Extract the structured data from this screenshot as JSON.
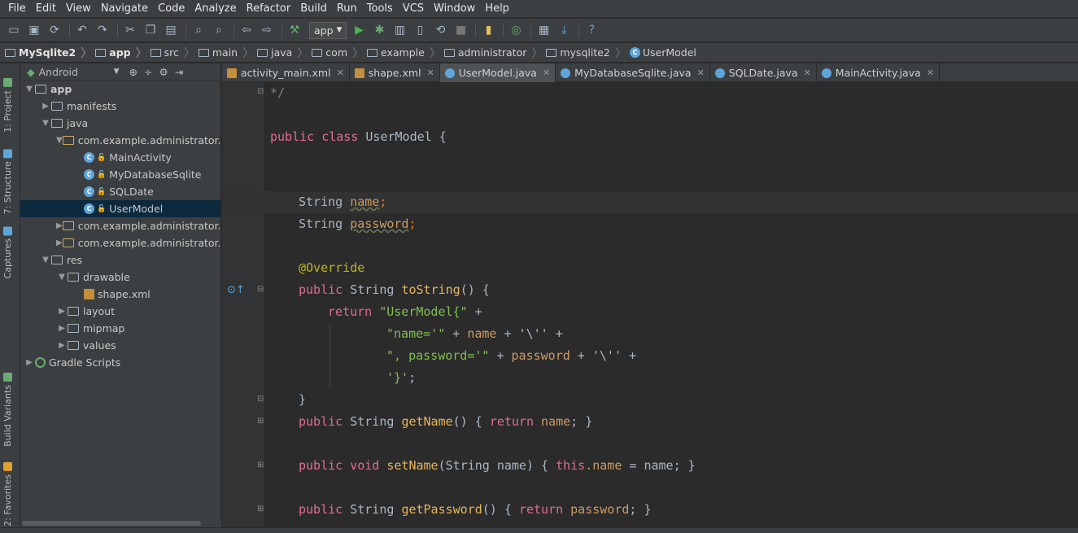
{
  "menu": [
    "File",
    "Edit",
    "View",
    "Navigate",
    "Code",
    "Analyze",
    "Refactor",
    "Build",
    "Run",
    "Tools",
    "VCS",
    "Window",
    "Help"
  ],
  "toolbar": {
    "run_config": "app"
  },
  "breadcrumbs": [
    "MySqlite2",
    "app",
    "src",
    "main",
    "java",
    "com",
    "example",
    "administrator",
    "mysqlite2",
    "UserModel"
  ],
  "side_tabs": {
    "project": "1: Project",
    "structure": "7: Structure",
    "captures": "Captures",
    "build_variants": "Build Variants",
    "favorites": "2: Favorites"
  },
  "project_panel": {
    "view_mode": "Android",
    "tree": [
      {
        "label": "app",
        "depth": 0,
        "kind": "module",
        "open": true
      },
      {
        "label": "manifests",
        "depth": 1,
        "kind": "folder",
        "open": false
      },
      {
        "label": "java",
        "depth": 1,
        "kind": "folder",
        "open": true
      },
      {
        "label": "com.example.administrator.m",
        "depth": 2,
        "kind": "package",
        "open": true
      },
      {
        "label": "MainActivity",
        "depth": 3,
        "kind": "class"
      },
      {
        "label": "MyDatabaseSqlite",
        "depth": 3,
        "kind": "class"
      },
      {
        "label": "SQLDate",
        "depth": 3,
        "kind": "class"
      },
      {
        "label": "UserModel",
        "depth": 3,
        "kind": "class",
        "selected": true
      },
      {
        "label": "com.example.administrator.m",
        "depth": 2,
        "kind": "package",
        "open": false
      },
      {
        "label": "com.example.administrator.m",
        "depth": 2,
        "kind": "package",
        "open": false
      },
      {
        "label": "res",
        "depth": 1,
        "kind": "folder",
        "open": true
      },
      {
        "label": "drawable",
        "depth": 2,
        "kind": "folder",
        "open": true
      },
      {
        "label": "shape.xml",
        "depth": 3,
        "kind": "xml"
      },
      {
        "label": "layout",
        "depth": 2,
        "kind": "folder",
        "open": false
      },
      {
        "label": "mipmap",
        "depth": 2,
        "kind": "folder",
        "open": false
      },
      {
        "label": "values",
        "depth": 2,
        "kind": "folder",
        "open": false
      },
      {
        "label": "Gradle Scripts",
        "depth": 0,
        "kind": "gradle",
        "open": false
      }
    ]
  },
  "tabs": [
    {
      "label": "activity_main.xml",
      "kind": "xml"
    },
    {
      "label": "shape.xml",
      "kind": "xml"
    },
    {
      "label": "UserModel.java",
      "kind": "class",
      "active": true
    },
    {
      "label": "MyDatabaseSqlite.java",
      "kind": "class"
    },
    {
      "label": "SQLDate.java",
      "kind": "class"
    },
    {
      "label": "MainActivity.java",
      "kind": "class"
    }
  ],
  "code": {
    "l0": "*/",
    "l1_kw": "public class",
    "l1_name": "UserModel",
    "l1_rest": " {",
    "l4_type": "String",
    "l4_field": "name",
    "l5_type": "String",
    "l5_field": "password",
    "l7": "@Override",
    "l8_kw": "public",
    "l8_type": " String ",
    "l8_meth": "toString",
    "l8_rest": "() {",
    "l9_kw": "return",
    "l9_str": " \"UserModel{\"",
    "l9_rest": " +",
    "l10_str": "\"name='\"",
    "l10_rest": " + ",
    "l10_field": "name",
    "l10_rest2": " + '\\'' +",
    "l11_str": "\", password='\"",
    "l11_rest": " + ",
    "l11_field": "password",
    "l11_rest2": " + '\\'' +",
    "l12_str": "'}'",
    "l12_rest": ";",
    "l13": "}",
    "l14_kw": "public",
    "l14_type": " String ",
    "l14_meth": "getName",
    "l14_rest": "() { ",
    "l14_kw2": "return",
    "l14_field": " name",
    "l14_end": "; }",
    "l16_kw": "public void",
    "l16_meth": " setName",
    "l16_rest": "(String name) { ",
    "l16_this": "this",
    "l16_field": ".name",
    "l16_end": " = name; }",
    "l18_kw": "public",
    "l18_type": " String ",
    "l18_meth": "getPassword",
    "l18_rest": "() { ",
    "l18_kw2": "return",
    "l18_field": " password",
    "l18_end": "; }"
  }
}
